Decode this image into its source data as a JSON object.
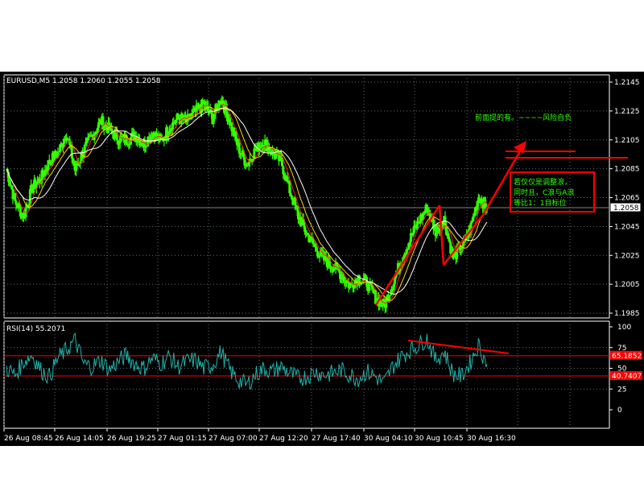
{
  "colors": {
    "background": "#000000",
    "grid": "#5a6e78",
    "axis": "#ffffff",
    "candles": "#32ff00",
    "ma_fast": "#ff2020",
    "ma_slow": "#ffd700",
    "ma_mid": "#ffffff",
    "rsi": "#20b2aa",
    "level": "#ff0000",
    "annotation": "#ff0000",
    "note_text": "#32ff00",
    "price_line": "#7f7f7f"
  },
  "chart_data": [
    {
      "type": "line",
      "title": "EURUSD,M5  1.2058 1.2060 1.2055 1.2058",
      "symbol": "EURUSD,M5",
      "ohlc": {
        "open": "1.2058",
        "high": "1.2060",
        "low": "1.2055",
        "close": "1.2058"
      },
      "ylim": [
        1.1985,
        1.2145
      ],
      "y_ticks": [
        "1.2145",
        "1.2125",
        "1.2105",
        "1.2085",
        "1.2065",
        "1.2045",
        "1.2025",
        "1.2005",
        "1.1985"
      ],
      "current_price": "1.2058",
      "x_ticks": [
        "26 Aug 08:45",
        "26 Aug 14:05",
        "26 Aug 19:25",
        "27 Aug 01:15",
        "27 Aug 07:00",
        "27 Aug 12:20",
        "27 Aug 17:40",
        "30 Aug 04:10",
        "30 Aug 10:45",
        "30 Aug 16:30"
      ],
      "series": [
        {
          "values": [
            1.2085,
            1.2062,
            1.2052,
            1.2072,
            1.2078,
            1.209,
            1.2096,
            1.211,
            1.2084,
            1.2098,
            1.2108,
            1.2118,
            1.2112,
            1.2106,
            1.2105,
            1.2108,
            1.2102,
            1.211,
            1.2104,
            1.2114,
            1.212,
            1.2118,
            1.2124,
            1.213,
            1.212,
            1.2134,
            1.2118,
            1.21,
            1.2088,
            1.2098,
            1.2104,
            1.2096,
            1.209,
            1.207,
            1.2052,
            1.204,
            1.203,
            1.2022,
            1.2018,
            1.2012,
            1.2004,
            1.201,
            1.2006,
            1.1996,
            1.199,
            1.2005,
            1.2022,
            1.2036,
            1.2048,
            1.2058,
            1.2042,
            1.205,
            1.2024,
            1.203,
            1.2042,
            1.2066,
            1.2058
          ]
        }
      ],
      "annotations": {
        "top_note": "前面提的有。~~~~风险自负",
        "box_note": [
          "若仅仅是调整浪，",
          "同时且，C浪与A浪",
          "等比1：1目标位"
        ]
      }
    },
    {
      "type": "line",
      "title": "RSI(14) 55.2071",
      "indicator": "RSI(14)",
      "current_value": "55.2071",
      "ylim": [
        0,
        100
      ],
      "y_ticks": [
        "100",
        "75",
        "50",
        "25",
        "0"
      ],
      "levels": [
        "65.1852",
        "40.7407"
      ],
      "series": [
        {
          "values": [
            50,
            42,
            58,
            66,
            48,
            40,
            62,
            72,
            84,
            55,
            52,
            60,
            48,
            58,
            66,
            55,
            50,
            62,
            56,
            64,
            52,
            58,
            60,
            50,
            54,
            70,
            48,
            36,
            30,
            42,
            50,
            46,
            52,
            44,
            38,
            40,
            46,
            42,
            44,
            48,
            42,
            38,
            46,
            40,
            32,
            52,
            64,
            72,
            78,
            86,
            60,
            70,
            44,
            40,
            56,
            78,
            55
          ]
        }
      ]
    }
  ]
}
